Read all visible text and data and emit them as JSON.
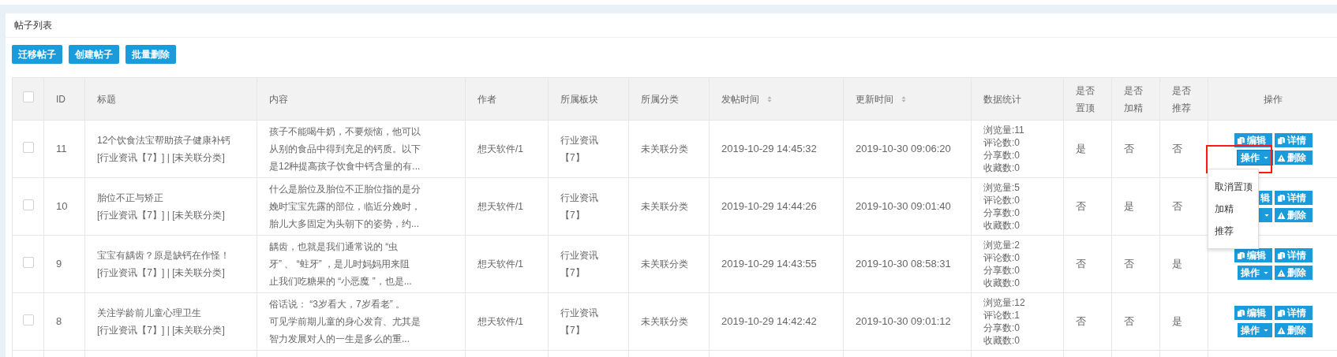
{
  "panel": {
    "title": "帖子列表"
  },
  "toolbar": [
    {
      "label": "迁移帖子"
    },
    {
      "label": "创建帖子"
    },
    {
      "label": "批量删除"
    }
  ],
  "table": {
    "select_all": {
      "checked": false
    },
    "columns": [
      {
        "label": "ID",
        "sortable": false
      },
      {
        "label": "标题",
        "sortable": false
      },
      {
        "label": "内容",
        "sortable": false
      },
      {
        "label": "作者",
        "sortable": false
      },
      {
        "label": "所属板块",
        "sortable": false
      },
      {
        "label": "所属分类",
        "sortable": false
      },
      {
        "label": "发帖时间",
        "sortable": true
      },
      {
        "label": "更新时间",
        "sortable": true
      },
      {
        "label": "数据统计",
        "sortable": false
      },
      {
        "label": "是否置顶",
        "sortable": false
      },
      {
        "label": "是否加精",
        "sortable": false
      },
      {
        "label": "是否推荐",
        "sortable": false
      },
      {
        "label": "操作",
        "sortable": false
      }
    ],
    "rows": [
      {
        "checked": false,
        "id": "11",
        "title": "12个饮食法宝帮助孩子健康补钙",
        "meta": "[行业资讯【7】] | [未关联分类]",
        "content": [
          "孩子不能喝牛奶，不要烦恼，他可以",
          "从别的食品中得到充足的钙质。以下",
          "是12种提高孩子饮食中钙含量的有..."
        ],
        "author": "想天软件/1",
        "board": "行业资讯【7】",
        "category": "未关联分类",
        "created": "2019-10-29 14:45:32",
        "updated": "2019-10-30 09:06:20",
        "stats": [
          "浏览量:11",
          "评论数:0",
          "分享数:0",
          "收藏数:0"
        ],
        "pinned": "是",
        "featured": "否",
        "recommended": "否",
        "covered": false,
        "actions": [
          {
            "kind": "edit",
            "label": "编辑"
          },
          {
            "kind": "detail",
            "label": "详情"
          },
          {
            "kind": "dropdown",
            "label": "操作",
            "expanded": true,
            "highlighted": true,
            "menu": [
              "取消置顶",
              "加精",
              "推荐"
            ]
          },
          {
            "kind": "delete",
            "label": "删除"
          }
        ]
      },
      {
        "checked": false,
        "id": "10",
        "title": "胎位不正与矫正",
        "meta": "[行业资讯【7】] | [未关联分类]",
        "content": [
          "什么是胎位及胎位不正胎位指的是分",
          "娩时宝宝先露的部位，临近分娩时，",
          "胎儿大多固定为头朝下的姿势，约..."
        ],
        "author": "想天软件/1",
        "board": "行业资讯【7】",
        "category": "未关联分类",
        "created": "2019-10-29 14:44:26",
        "updated": "2019-10-30 09:01:40",
        "stats": [
          "浏览量:5",
          "评论数:0",
          "分享数:0",
          "收藏数:0"
        ],
        "pinned": "否",
        "featured": "是",
        "recommended": "否",
        "covered": true,
        "actions": [
          {
            "kind": "edit",
            "label": "辑"
          },
          {
            "kind": "detail",
            "label": "详情"
          },
          {
            "kind": "dropdown",
            "expanded": false,
            "highlighted": false
          },
          {
            "kind": "delete",
            "label": "删除"
          }
        ]
      },
      {
        "checked": false,
        "id": "9",
        "title": "宝宝有龋齿？原是缺钙在作怪！",
        "meta": "[行业资讯【7】] | [未关联分类]",
        "content": [
          "龋齿，也就是我们通常说的 “虫",
          "牙” 、 “蛀牙” ，是儿时妈妈用来阻",
          "止我们吃糖果的 “小恶魔 ”，也是..."
        ],
        "author": "想天软件/1",
        "board": "行业资讯【7】",
        "category": "未关联分类",
        "created": "2019-10-29 14:43:55",
        "updated": "2019-10-30 08:58:31",
        "stats": [
          "浏览量:2",
          "评论数:0",
          "分享数:0",
          "收藏数:0"
        ],
        "pinned": "否",
        "featured": "否",
        "recommended": "是",
        "covered": false,
        "actions": [
          {
            "kind": "edit",
            "label": "编辑"
          },
          {
            "kind": "detail",
            "label": "详情"
          },
          {
            "kind": "dropdown",
            "label": "操作",
            "expanded": false,
            "highlighted": false
          },
          {
            "kind": "delete",
            "label": "删除"
          }
        ]
      },
      {
        "checked": false,
        "id": "8",
        "title": "关注学龄前儿童心理卫生",
        "meta": "[行业资讯【7】] | [未关联分类]",
        "content": [
          "俗话说： “3岁看大，7岁看老” 。",
          "可见学前期儿童的身心发育、尤其是",
          "智力发展对人的一生是多么的重..."
        ],
        "author": "想天软件/1",
        "board": "行业资讯【7】",
        "category": "未关联分类",
        "created": "2019-10-29 14:42:42",
        "updated": "2019-10-30 09:01:12",
        "stats": [
          "浏览量:12",
          "评论数:1",
          "分享数:0",
          "收藏数:0"
        ],
        "pinned": "否",
        "featured": "否",
        "recommended": "是",
        "covered": false,
        "actions": [
          {
            "kind": "edit",
            "label": "编辑"
          },
          {
            "kind": "detail",
            "label": "详情"
          },
          {
            "kind": "dropdown",
            "label": "操作",
            "expanded": false,
            "highlighted": false
          },
          {
            "kind": "delete",
            "label": "删除"
          }
        ]
      }
    ]
  }
}
